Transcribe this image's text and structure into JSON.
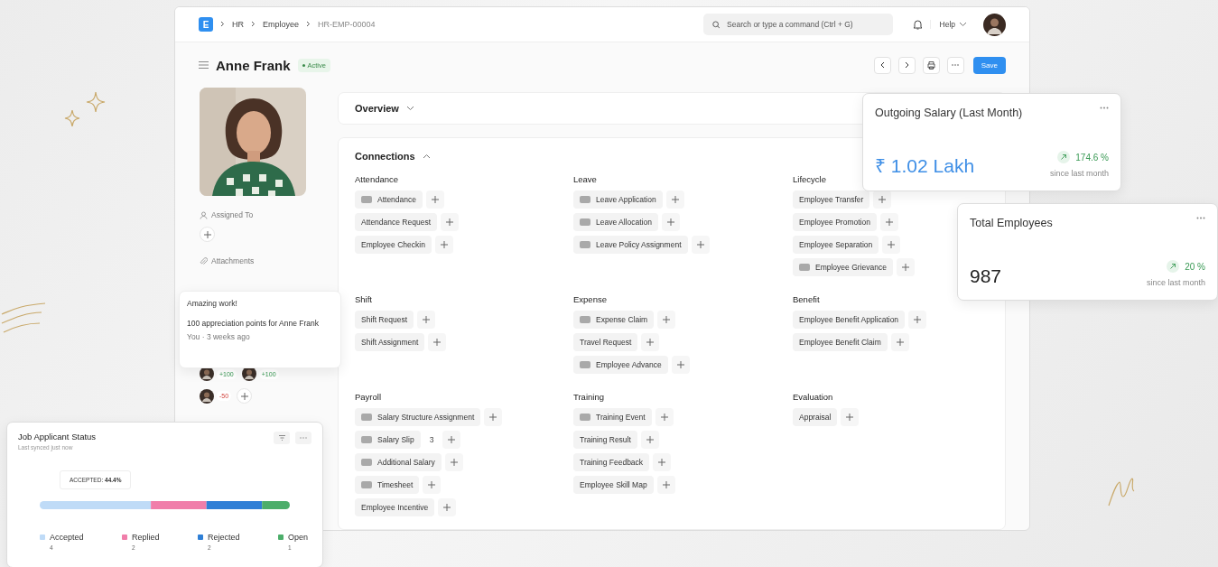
{
  "topbar": {
    "logo": "E",
    "breadcrumbs": [
      "HR",
      "Employee",
      "HR-EMP-00004"
    ],
    "search": {
      "placeholder": "Search or type a command (Ctrl + G)"
    },
    "help": "Help"
  },
  "header": {
    "title": "Anne Frank",
    "status": "Active",
    "save": "Save"
  },
  "sidebar": {
    "assigned_label": "Assigned To",
    "attachments_label": "Attachments",
    "appreciations": [
      {
        "points": "+100",
        "kind": "positive"
      },
      {
        "points": "+100",
        "kind": "positive"
      },
      {
        "points": "-50",
        "kind": "negative"
      }
    ]
  },
  "overview": {
    "title": "Overview",
    "expanded": false
  },
  "connections": {
    "title": "Connections",
    "expanded": true,
    "sections": [
      {
        "title": "Attendance",
        "items": [
          {
            "label": "Attendance",
            "badge": true
          },
          {
            "label": "Attendance Request",
            "badge": false
          },
          {
            "label": "Employee Checkin",
            "badge": false
          }
        ]
      },
      {
        "title": "Leave",
        "items": [
          {
            "label": "Leave Application",
            "badge": true
          },
          {
            "label": "Leave Allocation",
            "badge": true
          },
          {
            "label": "Leave Policy Assignment",
            "badge": true
          }
        ]
      },
      {
        "title": "Lifecycle",
        "items": [
          {
            "label": "Employee Transfer",
            "badge": false
          },
          {
            "label": "Employee Promotion",
            "badge": false
          },
          {
            "label": "Employee Separation",
            "badge": false
          },
          {
            "label": "Employee Grievance",
            "badge": true
          }
        ]
      },
      {
        "title": "Shift",
        "items": [
          {
            "label": "Shift Request",
            "badge": false
          },
          {
            "label": "Shift Assignment",
            "badge": false
          }
        ]
      },
      {
        "title": "Expense",
        "items": [
          {
            "label": "Expense Claim",
            "badge": true
          },
          {
            "label": "Travel Request",
            "badge": false
          },
          {
            "label": "Employee Advance",
            "badge": true
          }
        ]
      },
      {
        "title": "Benefit",
        "items": [
          {
            "label": "Employee Benefit Application",
            "badge": false
          },
          {
            "label": "Employee Benefit Claim",
            "badge": false
          }
        ]
      },
      {
        "title": "Payroll",
        "items": [
          {
            "label": "Salary Structure Assignment",
            "badge": true
          },
          {
            "label": "Salary Slip",
            "badge": true,
            "count": "3"
          },
          {
            "label": "Additional Salary",
            "badge": true
          },
          {
            "label": "Timesheet",
            "badge": true
          },
          {
            "label": "Employee Incentive",
            "badge": false
          }
        ]
      },
      {
        "title": "Training",
        "items": [
          {
            "label": "Training Event",
            "badge": true
          },
          {
            "label": "Training Result",
            "badge": false
          },
          {
            "label": "Training Feedback",
            "badge": false
          },
          {
            "label": "Employee Skill Map",
            "badge": false
          }
        ]
      },
      {
        "title": "Evaluation",
        "items": [
          {
            "label": "Appraisal",
            "badge": false
          }
        ]
      }
    ]
  },
  "popover": {
    "title": "Amazing work!",
    "message": "100 appreciation points for Anne Frank",
    "meta": "You · 3 weeks ago"
  },
  "stat_cards": [
    {
      "title": "Outgoing Salary (Last Month)",
      "value": "₹ 1.02 Lakh",
      "accent": true,
      "change": "174.6 %",
      "caption": "since last month"
    },
    {
      "title": "Total Employees",
      "value": "987",
      "accent": false,
      "change": "20 %",
      "caption": "since last month"
    }
  ],
  "job_applicant_card": {
    "title": "Job Applicant Status",
    "subtitle": "Last synced just now",
    "tooltip": "ACCEPTED: **44.4%**",
    "statuses": [
      {
        "label": "Accepted",
        "count": "4",
        "color": "#bfdbf7"
      },
      {
        "label": "Replied",
        "count": "2",
        "color": "#f07eaa"
      },
      {
        "label": "Rejected",
        "count": "2",
        "color": "#2f7fd6"
      },
      {
        "label": "Open",
        "count": "1",
        "color": "#4cae6a"
      }
    ]
  }
}
